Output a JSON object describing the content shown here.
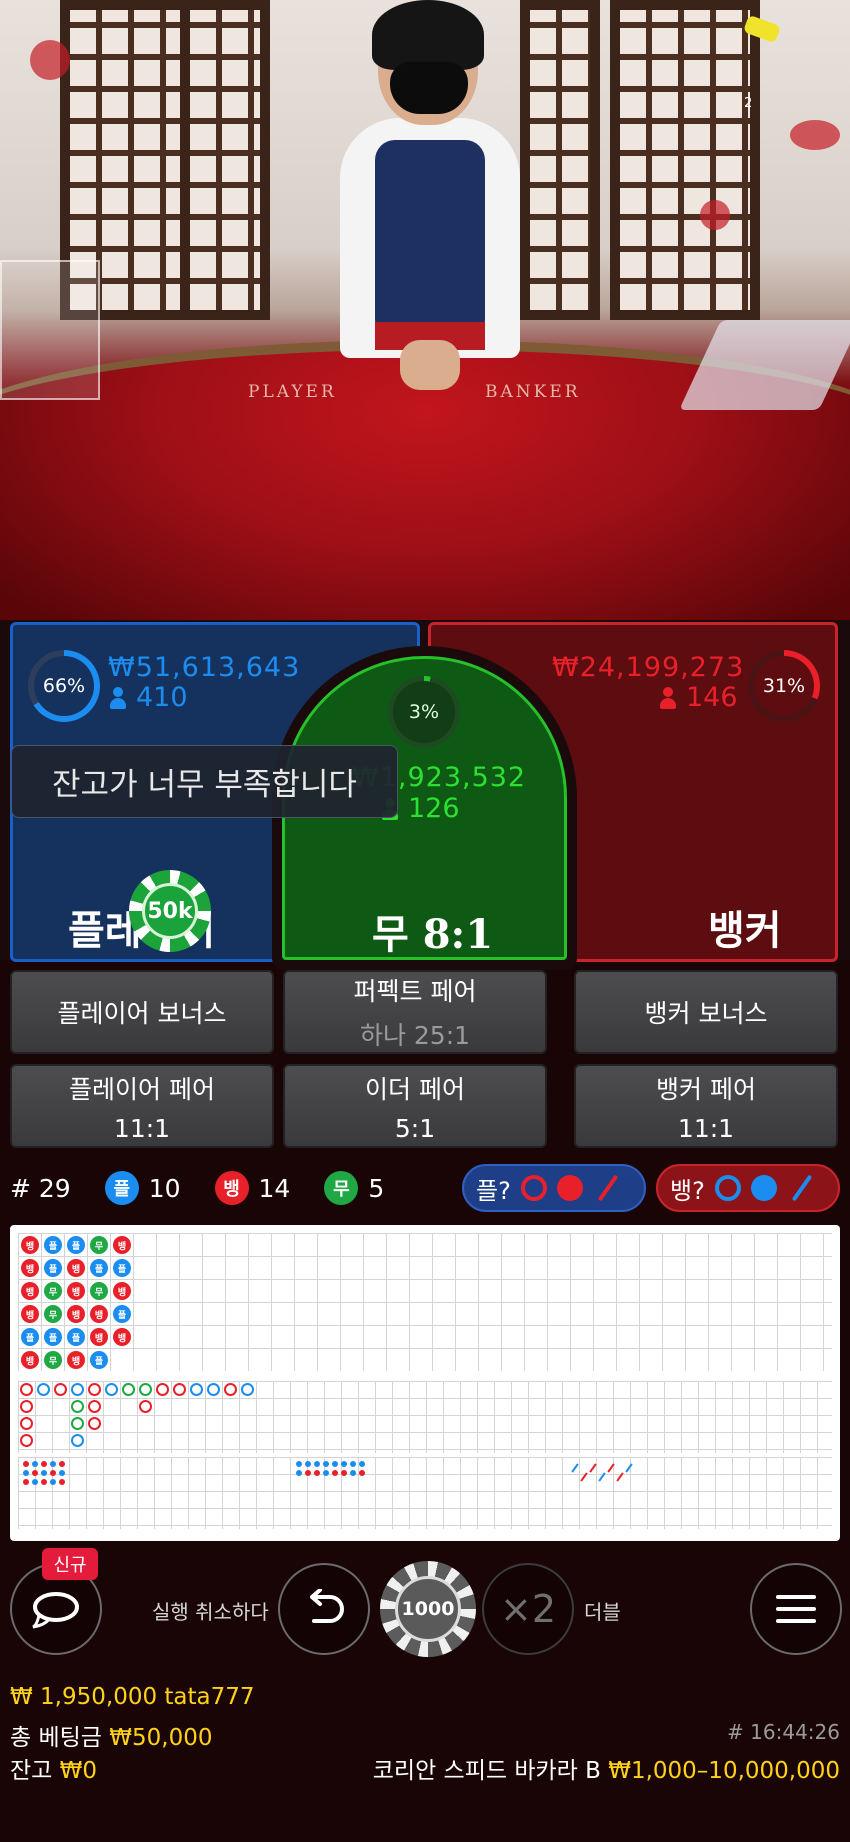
{
  "video": {
    "table_left_label": "PLAYER",
    "table_right_label": "BANKER",
    "camera_number": "2"
  },
  "bets": {
    "player": {
      "percent": "66%",
      "amount": "₩51,613,643",
      "players": "410",
      "label": "플레이어",
      "percent_value": 66
    },
    "tie": {
      "percent": "3%",
      "amount": "₩1,923,532",
      "players": "126",
      "label": "무 8:1",
      "percent_value": 3
    },
    "banker": {
      "percent": "31%",
      "amount": "₩24,199,273",
      "players": "146",
      "label": "뱅커",
      "percent_value": 31
    },
    "toast": "잔고가 너무 부족합니다",
    "placed_chip": "50k"
  },
  "side_bets": [
    {
      "label": "플레이어 보너스",
      "odds": ""
    },
    {
      "label": "퍼펙트 페어",
      "odds": "하나 25:1"
    },
    {
      "label": "뱅커 보너스",
      "odds": ""
    },
    {
      "label": "플레이어 페어",
      "odds": "11:1"
    },
    {
      "label": "이더 페어",
      "odds": "5:1"
    },
    {
      "label": "뱅커 페어",
      "odds": "11:1"
    }
  ],
  "stats": {
    "rounds": "# 29",
    "player_badge": "플",
    "player_count": "10",
    "banker_badge": "뱅",
    "banker_count": "14",
    "tie_badge": "무",
    "tie_count": "5",
    "player_predict": "플?",
    "banker_predict": "뱅?"
  },
  "bead_road": [
    [
      "뱅",
      "뱅",
      "뱅",
      "뱅",
      "플",
      "뱅"
    ],
    [
      "플",
      "플",
      "무",
      "무",
      "플",
      "무"
    ],
    [
      "플",
      "뱅",
      "뱅",
      "뱅",
      "플",
      "뱅"
    ],
    [
      "무",
      "플",
      "무",
      "뱅",
      "뱅",
      "플"
    ],
    [
      "뱅",
      "플",
      "뱅",
      "플",
      "뱅",
      ""
    ]
  ],
  "controls": {
    "new_badge": "신규",
    "undo_label": "실행 취소하다",
    "chip_value": "1000",
    "double_symbol": "×2",
    "double_label": "더블"
  },
  "footer": {
    "balance_user": "₩ 1,950,000 tata777",
    "total_bet_label": "총 베팅금",
    "total_bet_value": "₩50,000",
    "balance_label": "잔고",
    "balance_value": "₩0",
    "time": "# 16:44:26",
    "table_name": "코리안 스피드 바카라 B",
    "limits": "₩1,000–10,000,000"
  },
  "colors": {
    "player": "#1b8df0",
    "banker": "#e8202a",
    "tie": "#1fa844",
    "gold": "#ffd21a"
  }
}
